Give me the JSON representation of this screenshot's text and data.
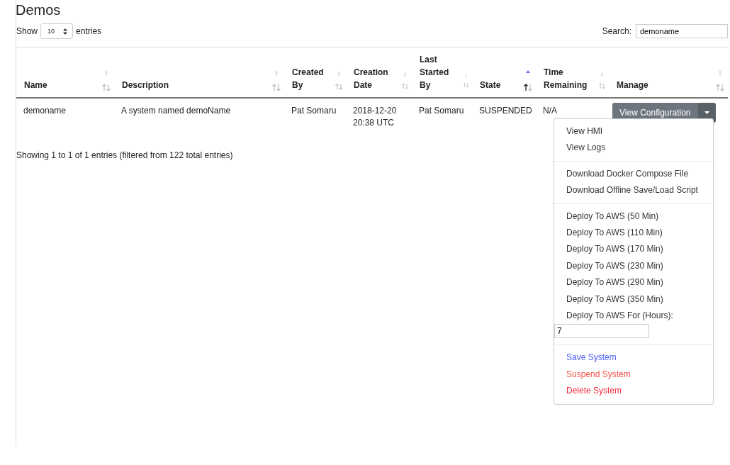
{
  "page_title": "Demos",
  "length_menu": {
    "label_before": "Show",
    "value": "10",
    "label_after": "entries"
  },
  "search": {
    "label": "Search:",
    "value": "demoname"
  },
  "table": {
    "columns": [
      {
        "label": "Name",
        "sorted": false
      },
      {
        "label": "Description",
        "sorted": false
      },
      {
        "label": "Created By",
        "sorted": false
      },
      {
        "label": "Creation Date",
        "sorted": false
      },
      {
        "label": "Last Started By",
        "sorted": false
      },
      {
        "label": "State",
        "sorted": true
      },
      {
        "label": "Time Remaining",
        "sorted": false
      },
      {
        "label": "Manage",
        "sorted": false
      }
    ],
    "rows": [
      {
        "cells": [
          "demoname",
          "A system named demoName",
          "Pat Somaru",
          "2018-12-20 20:38 UTC",
          "Pat Somaru",
          "SUSPENDED",
          "N/A"
        ],
        "action": "View Configuration"
      }
    ]
  },
  "info": "Showing 1 to 1 of 1 entries (filtered from 122 total entries)",
  "menu": {
    "groups": [
      [
        {
          "kind": "link",
          "label": "View HMI",
          "color": "#333333"
        },
        {
          "kind": "link",
          "label": "View Logs",
          "color": "#333333"
        }
      ],
      [
        {
          "kind": "link",
          "label": "Download Docker Compose File",
          "color": "#333333"
        },
        {
          "kind": "link",
          "label": "Download Offline Save/Load Script",
          "color": "#333333"
        }
      ],
      [
        {
          "kind": "link",
          "label": "Deploy To AWS (50 Min)",
          "color": "#333333"
        },
        {
          "kind": "link",
          "label": "Deploy To AWS (110 Min)",
          "color": "#333333"
        },
        {
          "kind": "link",
          "label": "Deploy To AWS (170 Min)",
          "color": "#333333"
        },
        {
          "kind": "link",
          "label": "Deploy To AWS (230 Min)",
          "color": "#333333"
        },
        {
          "kind": "link",
          "label": "Deploy To AWS (290 Min)",
          "color": "#333333"
        },
        {
          "kind": "link",
          "label": "Deploy To AWS (350 Min)",
          "color": "#333333"
        },
        {
          "kind": "label",
          "label": "Deploy To AWS For (Hours):",
          "color": "#333333"
        },
        {
          "kind": "input",
          "value": "7"
        }
      ],
      [
        {
          "kind": "link",
          "label": "Save System",
          "color": "#4d5ef7"
        },
        {
          "kind": "link",
          "label": "Suspend System",
          "color": "#f5544a"
        },
        {
          "kind": "link",
          "label": "Delete System",
          "color": "#f0283c"
        }
      ]
    ]
  }
}
